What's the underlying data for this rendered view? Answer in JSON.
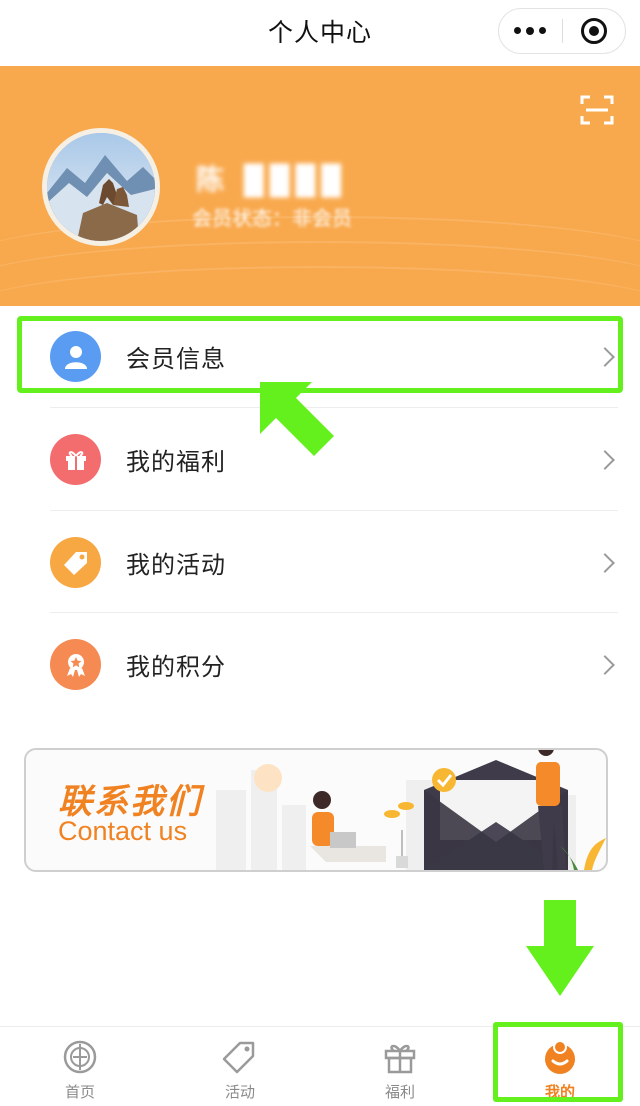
{
  "navbar": {
    "title": "个人中心"
  },
  "profile": {
    "username": "陈 ████",
    "member_status": "会员状态：非会员"
  },
  "menu": [
    {
      "label": "会员信息",
      "icon": "user-icon",
      "color": "#5b9cf3"
    },
    {
      "label": "我的福利",
      "icon": "gift-icon",
      "color": "#f36d6f"
    },
    {
      "label": "我的活动",
      "icon": "tag-icon",
      "color": "#f7a843"
    },
    {
      "label": "我的积分",
      "icon": "badge-icon",
      "color": "#f58a52"
    }
  ],
  "banner": {
    "title_cn": "联系我们",
    "title_en": "Contact us"
  },
  "tabbar": [
    {
      "label": "首页",
      "icon": "home-icon",
      "active": false
    },
    {
      "label": "活动",
      "icon": "tag-icon",
      "active": false
    },
    {
      "label": "福利",
      "icon": "gift-icon",
      "active": false
    },
    {
      "label": "我的",
      "icon": "user-icon",
      "active": true
    }
  ],
  "colors": {
    "header_bg": "#f9a94d",
    "accent": "#f08222",
    "annotation_green": "#64f01c"
  }
}
